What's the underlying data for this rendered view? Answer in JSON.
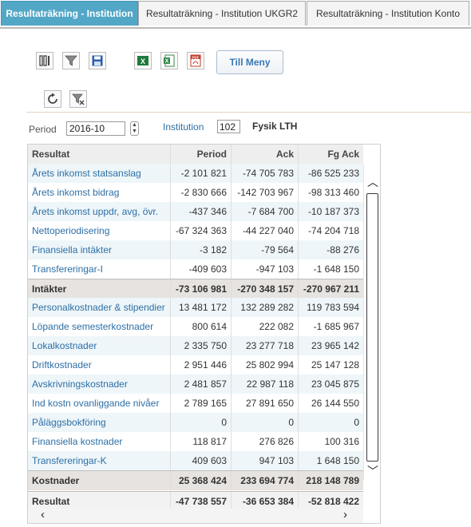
{
  "tabs": [
    {
      "label": "Resultaträkning - Institution",
      "active": true
    },
    {
      "label": "Resultaträkning - Institution UKGR2",
      "active": false
    },
    {
      "label": "Resultaträkning - Institution Konto",
      "active": false
    }
  ],
  "toolbar": {
    "menu_label": "Till Meny",
    "icons": [
      "columns-icon",
      "filter-icon",
      "save-icon",
      "excel-icon",
      "excel-export-icon",
      "pdf-icon",
      "refresh-icon",
      "filter-clear-icon"
    ]
  },
  "filters": {
    "period_label": "Period",
    "period_value": "2016-10",
    "institution_label": "Institution",
    "institution_value": "102",
    "institution_name": "Fysik LTH"
  },
  "grid": {
    "columns": [
      "Resultat",
      "Period",
      "Ack",
      "Fg Ack"
    ],
    "rows": [
      {
        "label": "Årets inkomst statsanslag",
        "period": "-2 101 821",
        "ack": "-74 705 783",
        "fg_ack": "-86 525 233",
        "kind": "data"
      },
      {
        "label": "Årets inkomst bidrag",
        "period": "-2 830 666",
        "ack": "-142 703 967",
        "fg_ack": "-98 313 460",
        "kind": "data"
      },
      {
        "label": "Årets inkomst uppdr, avg, övr.",
        "period": "-437 346",
        "ack": "-7 684 700",
        "fg_ack": "-10 187 373",
        "kind": "data"
      },
      {
        "label": "Nettoperiodisering",
        "period": "-67 324 363",
        "ack": "-44 227 040",
        "fg_ack": "-74 204 718",
        "kind": "data"
      },
      {
        "label": "Finansiella intäkter",
        "period": "-3 182",
        "ack": "-79 564",
        "fg_ack": "-88 276",
        "kind": "data"
      },
      {
        "label": "Transfereringar-I",
        "period": "-409 603",
        "ack": "-947 103",
        "fg_ack": "-1 648 150",
        "kind": "data"
      },
      {
        "label": "Intäkter",
        "period": "-73 106 981",
        "ack": "-270 348 157",
        "fg_ack": "-270 967 211",
        "kind": "sum"
      },
      {
        "label": "Personalkostnader & stipendier",
        "period": "13 481 172",
        "ack": "132 289 282",
        "fg_ack": "119 783 594",
        "kind": "data"
      },
      {
        "label": "Löpande semesterkostnader",
        "period": "800 614",
        "ack": "222 082",
        "fg_ack": "-1 685 967",
        "kind": "data"
      },
      {
        "label": "Lokalkostnader",
        "period": "2 335 750",
        "ack": "23 277 718",
        "fg_ack": "23 965 142",
        "kind": "data"
      },
      {
        "label": "Driftkostnader",
        "period": "2 951 446",
        "ack": "25 802 994",
        "fg_ack": "25 147 128",
        "kind": "data"
      },
      {
        "label": "Avskrivningskostnader",
        "period": "2 481 857",
        "ack": "22 987 118",
        "fg_ack": "23 045 875",
        "kind": "data"
      },
      {
        "label": "Ind kostn ovanliggande nivåer",
        "period": "2 789 165",
        "ack": "27 891 650",
        "fg_ack": "26 144 550",
        "kind": "data"
      },
      {
        "label": "Påläggsbokföring",
        "period": "0",
        "ack": "0",
        "fg_ack": "0",
        "kind": "data"
      },
      {
        "label": "Finansiella kostnader",
        "period": "118 817",
        "ack": "276 826",
        "fg_ack": "100 316",
        "kind": "data"
      },
      {
        "label": "Transfereringar-K",
        "period": "409 603",
        "ack": "947 103",
        "fg_ack": "1 648 150",
        "kind": "data"
      },
      {
        "label": "Kostnader",
        "period": "25 368 424",
        "ack": "233 694 774",
        "fg_ack": "218 148 789",
        "kind": "sum"
      }
    ],
    "total": {
      "label": "Resultat",
      "period": "-47 738 557",
      "ack": "-36 653 384",
      "fg_ack": "-52 818 422"
    }
  }
}
